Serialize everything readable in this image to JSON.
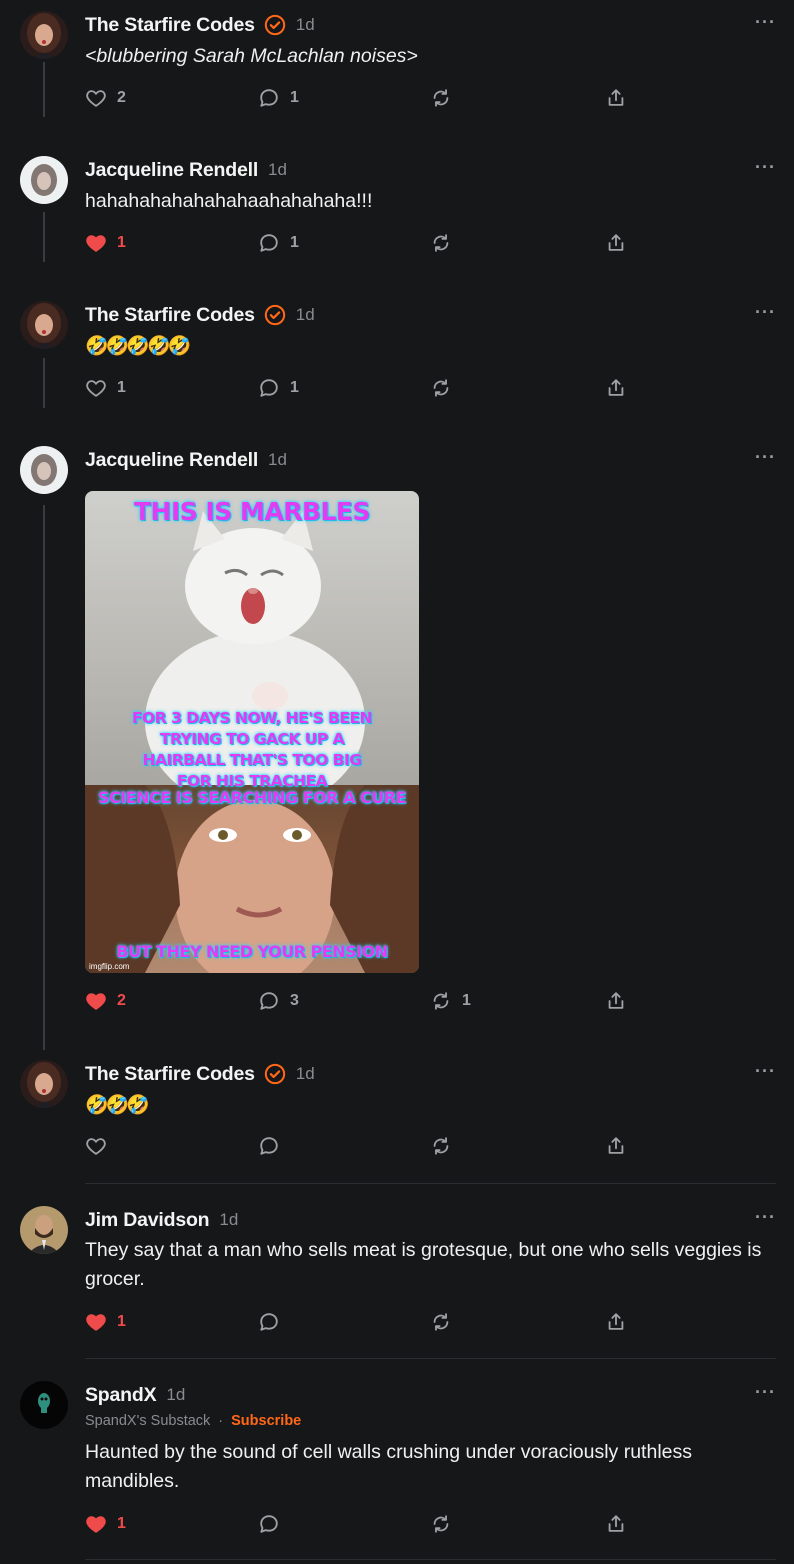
{
  "comments": [
    {
      "author": "The Starfire Codes",
      "time": "1d",
      "text": "<blubbering Sarah McLachlan noises>",
      "likes": "2",
      "replies": "1",
      "restacks": ""
    },
    {
      "author": "Jacqueline Rendell",
      "time": "1d",
      "text": "hahahahahahahahaahahahaha!!!",
      "likes": "1",
      "replies": "1",
      "restacks": ""
    },
    {
      "author": "The Starfire Codes",
      "time": "1d",
      "text": "🤣🤣🤣🤣🤣",
      "likes": "1",
      "replies": "1",
      "restacks": ""
    },
    {
      "author": "Jacqueline Rendell",
      "time": "1d",
      "text": "",
      "likes": "2",
      "replies": "3",
      "restacks": "1",
      "meme": {
        "caption_top": "THIS IS MARBLES",
        "caption_middle": "FOR 3 DAYS NOW, HE'S BEEN TRYING TO GACK UP A HAIRBALL THAT'S TOO BIG FOR HIS TRACHEA",
        "caption_lower": "SCIENCE IS SEARCHING FOR A CURE",
        "caption_bottom": "BUT THEY NEED YOUR PENSION",
        "watermark": "imgflip.com"
      }
    },
    {
      "author": "The Starfire Codes",
      "time": "1d",
      "text": "🤣🤣🤣",
      "likes": "",
      "replies": "",
      "restacks": ""
    },
    {
      "author": "Jim Davidson",
      "time": "1d",
      "text": "They say that a man who sells meat is grotesque, but one who sells veggies is grocer.",
      "likes": "1",
      "replies": "",
      "restacks": ""
    },
    {
      "author": "SpandX",
      "time": "1d",
      "publication": "SpandX's Substack",
      "subscribe": "Subscribe",
      "text": "Haunted by the sound of cell walls crushing under voraciously ruthless mandibles.",
      "likes": "1",
      "replies": "",
      "restacks": ""
    }
  ],
  "more_menu": "···",
  "colors": {
    "accent": "#ff6719",
    "liked": "#f04b4b",
    "background": "#161719"
  },
  "icons": [
    "heart-icon",
    "comment-icon",
    "restack-icon",
    "share-icon",
    "verified-icon",
    "more-icon"
  ]
}
